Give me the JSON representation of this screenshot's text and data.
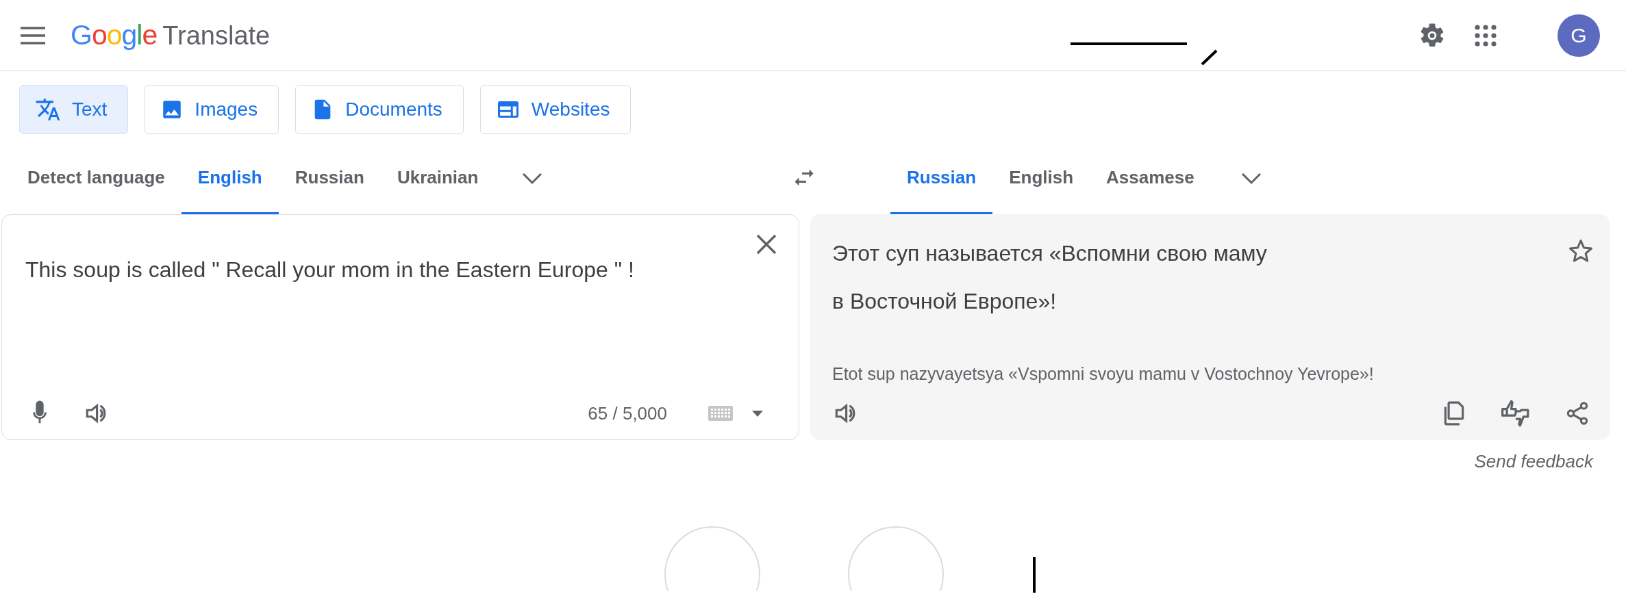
{
  "header": {
    "logo_brand": "Google",
    "logo_product": "Translate",
    "avatar_letter": "G"
  },
  "mode_tabs": [
    {
      "label": "Text",
      "kind": "text",
      "selected": true
    },
    {
      "label": "Images",
      "kind": "image",
      "selected": false
    },
    {
      "label": "Documents",
      "kind": "document",
      "selected": false
    },
    {
      "label": "Websites",
      "kind": "website",
      "selected": false
    }
  ],
  "source_languages": [
    {
      "label": "Detect language",
      "selected": false
    },
    {
      "label": "English",
      "selected": true
    },
    {
      "label": "Russian",
      "selected": false
    },
    {
      "label": "Ukrainian",
      "selected": false
    }
  ],
  "target_languages": [
    {
      "label": "Russian",
      "selected": true
    },
    {
      "label": "English",
      "selected": false
    },
    {
      "label": "Assamese",
      "selected": false
    }
  ],
  "source": {
    "value": "This soup is called \" Recall your mom in the Eastern Europe \" !",
    "char_count": "65 / 5,000"
  },
  "target": {
    "translation": "Этот суп называется «Вспомни свою маму в Восточной Европе»!",
    "transliteration": "Etot sup nazyvayetsya «Vspomni svoyu mamu v Vostochnoy Yevrope»!"
  },
  "send_feedback": "Send feedback"
}
